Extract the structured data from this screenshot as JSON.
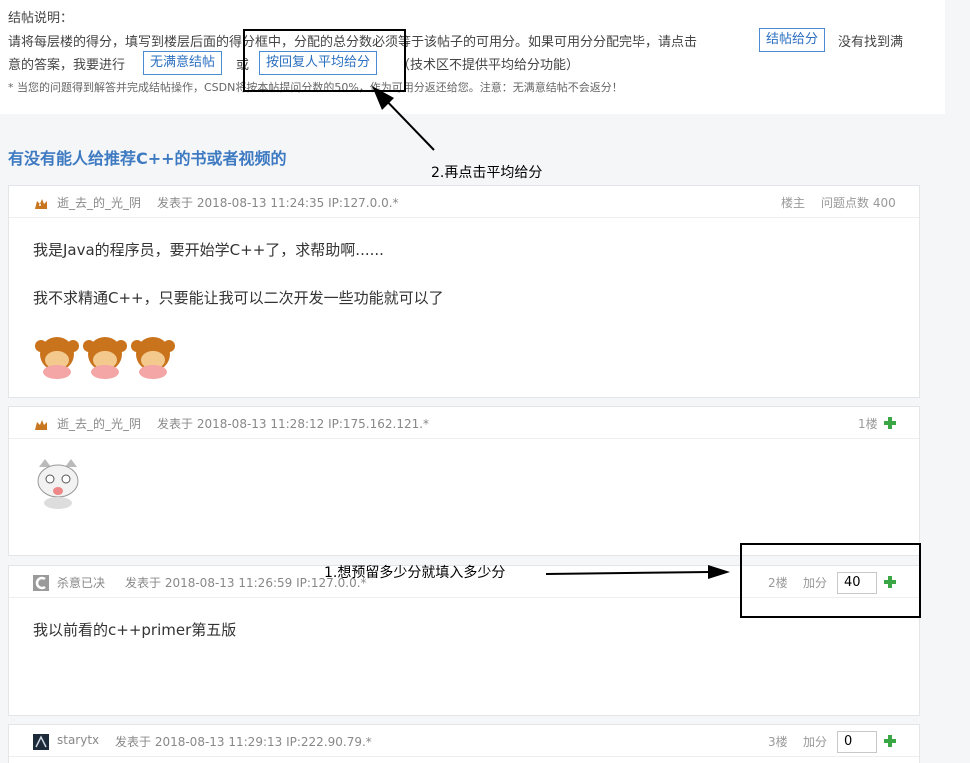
{
  "notice": {
    "title": "结帖说明：",
    "line1_text": "请将每层楼的得分，填写到楼层后面的得分框中，分配的总分数必须等于该帖子的可用分。如果可用分分配完毕，请点击",
    "line1_button": "结帖给分",
    "line1_tail": "没有找到满",
    "line2_head": "意的答案，我要进行",
    "line2_button_unsatisfied": "无满意结帖",
    "line2_or": "或",
    "line2_button_average": "按回复人平均给分",
    "line2_tail": "（技术区不提供平均给分功能）",
    "line3": "* 当您的问题得到解答并完成结帖操作，CSDN将按本帖提问分数的50%，作为可用分返还给您。注意：无满意结帖不会返分！"
  },
  "topic": {
    "title": "有没有能人给推荐C++的书或者视频的"
  },
  "annotations": {
    "step2": "2.再点击平均给分",
    "step1": "1.想预留多少分就填入多少分"
  },
  "floors": [
    {
      "username": "逝_去_的_光_阴",
      "posted": "发表于 2018-08-13 11:24:35 IP:127.0.0.*",
      "role": "楼主",
      "points_label": "问题点数 400",
      "lines": [
        "我是Java的程序员，要开始学C++了，求帮助啊......",
        "我不求精通C++，只要能让我可以二次开发一些功能就可以了"
      ]
    },
    {
      "username": "逝_去_的_光_阴",
      "posted": "发表于 2018-08-13 11:28:12 IP:175.162.121.*",
      "floor_no": "1楼"
    },
    {
      "username": "杀意已决",
      "posted": "发表于 2018-08-13 11:26:59 IP:127.0.0.*",
      "floor_no": "2楼",
      "add_label": "加分",
      "score": "40",
      "lines": [
        "我以前看的c++primer第五版"
      ]
    },
    {
      "username": "starytx",
      "posted": "发表于 2018-08-13 11:29:13 IP:222.90.79.*",
      "floor_no": "3楼",
      "add_label": "加分",
      "score": "0"
    }
  ],
  "colors": {
    "accent_blue": "#3e7ac2",
    "plus_green": "#3aa644"
  }
}
